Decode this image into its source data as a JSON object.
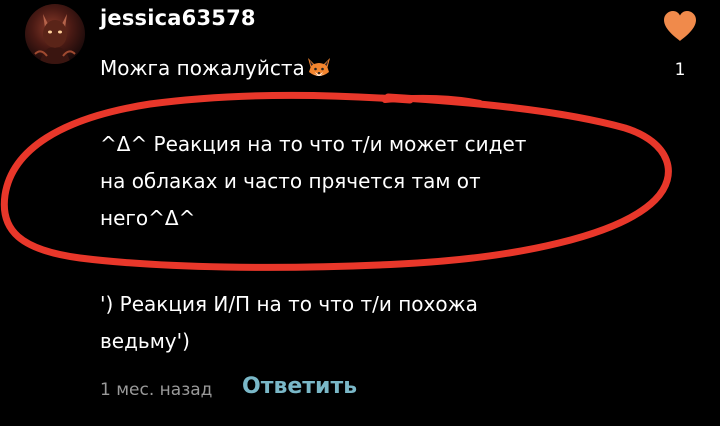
{
  "comment": {
    "username": "jessica63578",
    "first_line": "Можга пожалуйста",
    "emoji_icon": "fox-emoji-icon",
    "paragraph_1": [
      "^Δ^ Реакция на то что т/и может сидет",
      "на облаках и часто прячется там от",
      "него^Δ^"
    ],
    "paragraph_2": [
      "') Реакция И/П на то что т/и похожа",
      "ведьму')"
    ],
    "timestamp": "1 мес. назад",
    "reply_label": "Ответить"
  },
  "like": {
    "icon": "heart-icon",
    "count": "1",
    "color": "#f08a4b"
  },
  "colors": {
    "background": "#000000",
    "text": "#ffffff",
    "muted": "#9a9a9a",
    "reply": "#7ab8c8",
    "annotation": "#e8372a"
  }
}
